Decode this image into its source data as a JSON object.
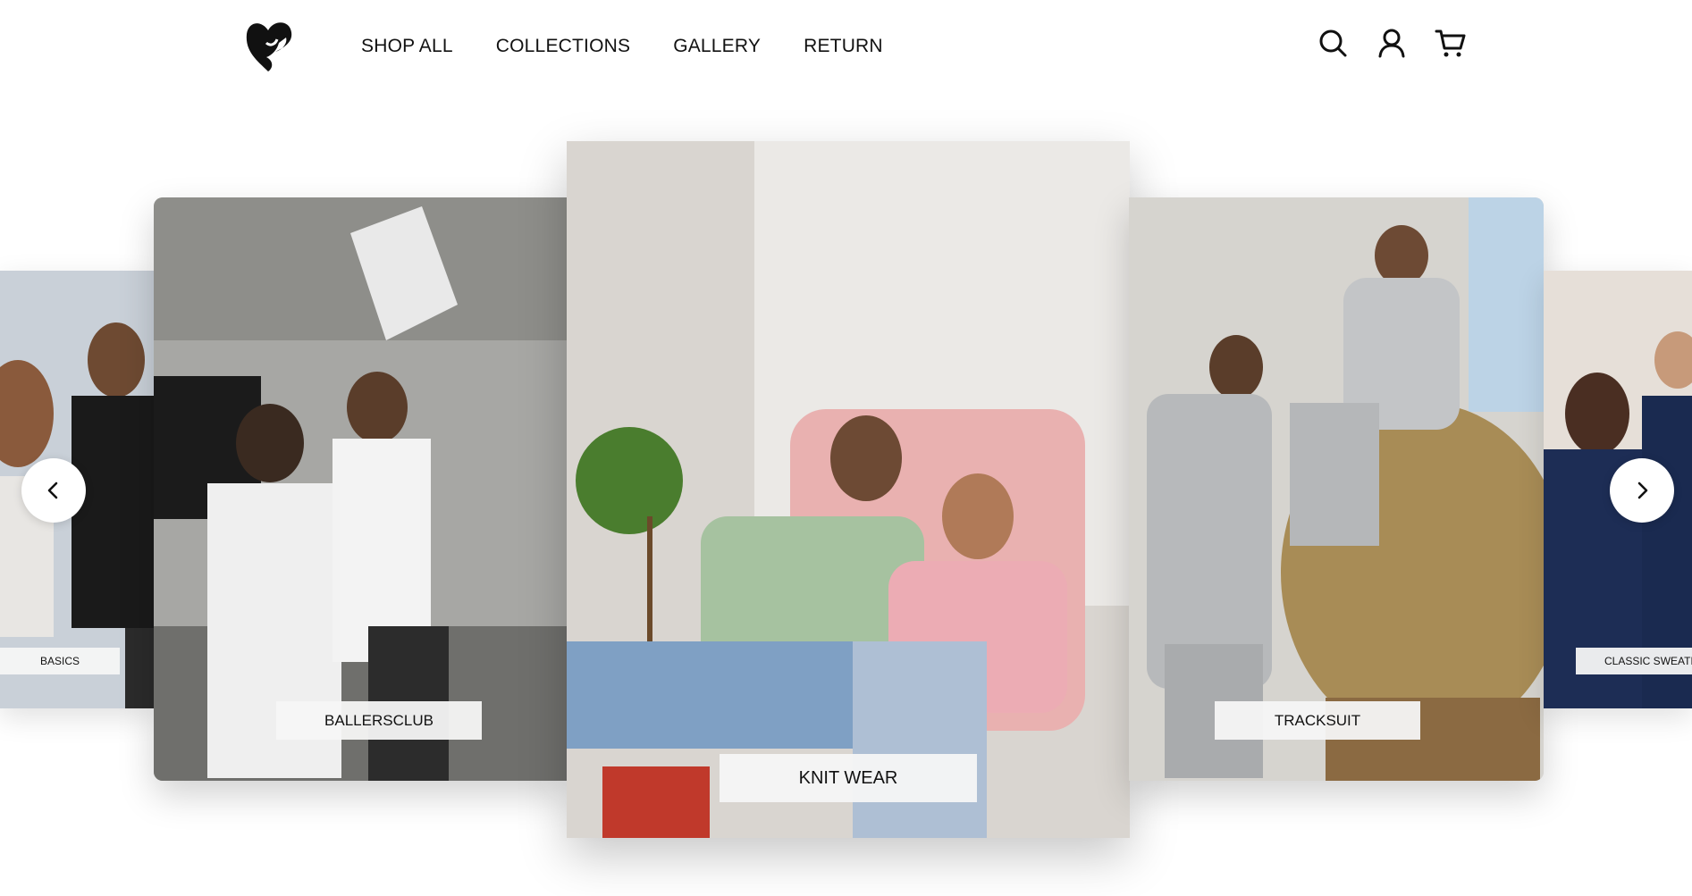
{
  "brand": {
    "logo_icon": "heart-logo-icon"
  },
  "nav": {
    "items": [
      {
        "label": "SHOP ALL"
      },
      {
        "label": "COLLECTIONS"
      },
      {
        "label": "GALLERY"
      },
      {
        "label": "RETURN"
      }
    ]
  },
  "header_icons": [
    "search-icon",
    "account-icon",
    "cart-icon"
  ],
  "carousel": {
    "slides": [
      {
        "label": "BASICS"
      },
      {
        "label": "BALLERSCLUB"
      },
      {
        "label": "KNIT WEAR"
      },
      {
        "label": "TRACKSUIT"
      },
      {
        "label": "CLASSIC SWEATE"
      }
    ],
    "prev_icon": "chevron-left-icon",
    "next_icon": "chevron-right-icon"
  },
  "colors": {
    "background": "#ffffff",
    "text": "#111111",
    "label_bg": "#f5f5f5"
  }
}
